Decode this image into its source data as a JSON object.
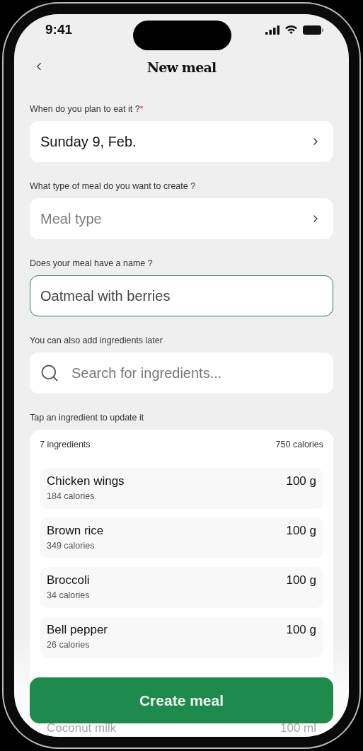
{
  "status_bar": {
    "time": "9:41"
  },
  "header": {
    "title": "New meal"
  },
  "fields": [
    {
      "kind": "select",
      "label": "When do you plan to eat it ?",
      "required_mark": "*",
      "value": "Sunday 9, Feb.",
      "focused": false
    },
    {
      "kind": "select",
      "label": "What type of meal do you want to create ?",
      "placeholder": "Meal type",
      "focused": false
    },
    {
      "kind": "text",
      "label": "Does your meal have a name ?",
      "value": "Oatmeal with berries",
      "focused": true
    },
    {
      "kind": "search",
      "label": "You can also add ingredients later",
      "placeholder": "Search for ingredients...",
      "focused": false
    }
  ],
  "ingredients": {
    "label": "Tap an ingredient to update it",
    "count": "7 ingredients",
    "total": "750 calories",
    "rows": [
      {
        "name": "Chicken wings",
        "calories": "184 calories",
        "amount": "100 g"
      },
      {
        "name": "Brown rice",
        "calories": "349 calories",
        "amount": "100 g"
      },
      {
        "name": "Broccoli",
        "calories": "34 calories",
        "amount": "100 g"
      },
      {
        "name": "Bell pepper",
        "calories": "26 calories",
        "amount": "100 g"
      }
    ],
    "under_button_row": {
      "name": "Coconut milk",
      "amount": "100 ml"
    }
  },
  "button": {
    "label": "Create meal"
  }
}
